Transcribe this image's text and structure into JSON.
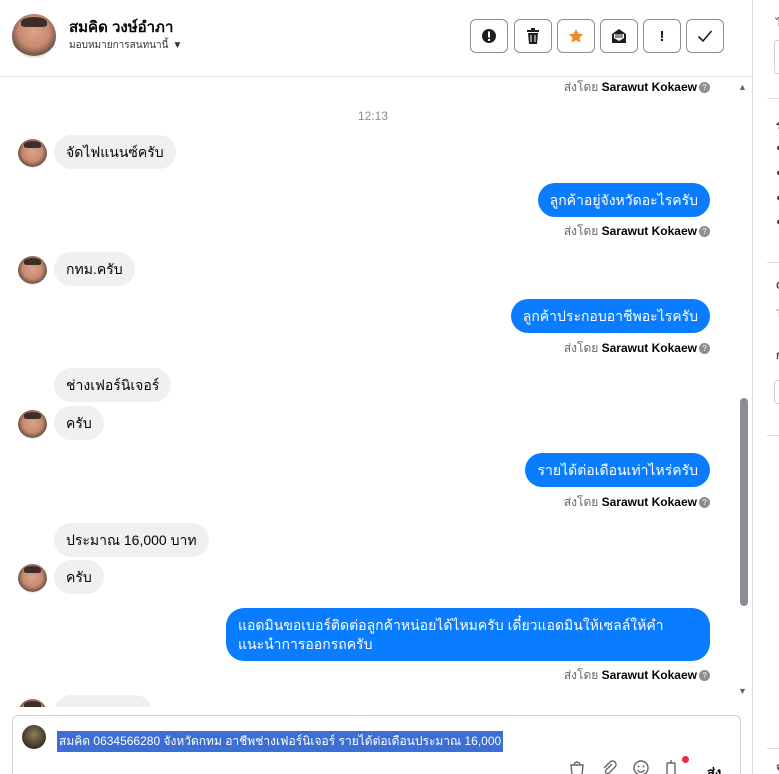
{
  "header": {
    "contact_name": "สมคิด วงษ์อำภา",
    "assign_label": "มอบหมายการสนทนานี้",
    "toolbar": [
      {
        "name": "spam-button",
        "icon": "alert-circle-icon",
        "glyph": "⬤"
      },
      {
        "name": "delete-button",
        "icon": "trash-icon",
        "glyph": "🗑"
      },
      {
        "name": "star-button",
        "icon": "star-icon",
        "glyph": "★"
      },
      {
        "name": "unread-button",
        "icon": "envelope-icon",
        "glyph": "✉"
      },
      {
        "name": "follow-up-button",
        "icon": "exclamation-icon",
        "glyph": "!"
      },
      {
        "name": "done-button",
        "icon": "check-icon",
        "glyph": "✓"
      }
    ]
  },
  "conversation": {
    "sent_by_prefix": "ส่งโดย",
    "agent_name": "Sarawut Kokaew",
    "time": "12:13",
    "messages": [
      {
        "dir": "in",
        "text": "จัดไฟแนนซ์ครับ"
      },
      {
        "dir": "out",
        "text": "ลูกค้าอยู่จังหวัดอะไรครับ"
      },
      {
        "dir": "in",
        "text": "กทม.ครับ"
      },
      {
        "dir": "out",
        "text": "ลูกค้าประกอบอาชีพอะไรครับ"
      },
      {
        "dir": "in",
        "text": "ช่างเฟอร์นิเจอร์"
      },
      {
        "dir": "in",
        "text": "ครับ"
      },
      {
        "dir": "out",
        "text": "รายได้ต่อเดือนเท่าไหร่ครับ"
      },
      {
        "dir": "in",
        "text": "ประมาณ 16,000 บาท"
      },
      {
        "dir": "in",
        "text": "ครับ"
      },
      {
        "dir": "out",
        "text": "แอดมินขอเบอร์ติดต่อลูกค้าหน่อยได้ไหมครับ เดี๋ยวแอดมินให้เซลล์ให้คำแนะนำการออกรถครับ"
      }
    ]
  },
  "composer": {
    "draft_text": "สมคิด 0634566280 จังหวัดกทม อาชีพช่างเฟอร์นิเจอร์ รายได้ต่อเดือนประมาณ 16,000",
    "send_label": "ส่ง",
    "icons": [
      "bag-icon",
      "paperclip-icon",
      "emoji-icon",
      "bot-icon"
    ]
  },
  "colors": {
    "outgoing_bubble": "#0a7cff",
    "incoming_bubble": "#f0f0f0",
    "selection": "#3b6fd3"
  }
}
